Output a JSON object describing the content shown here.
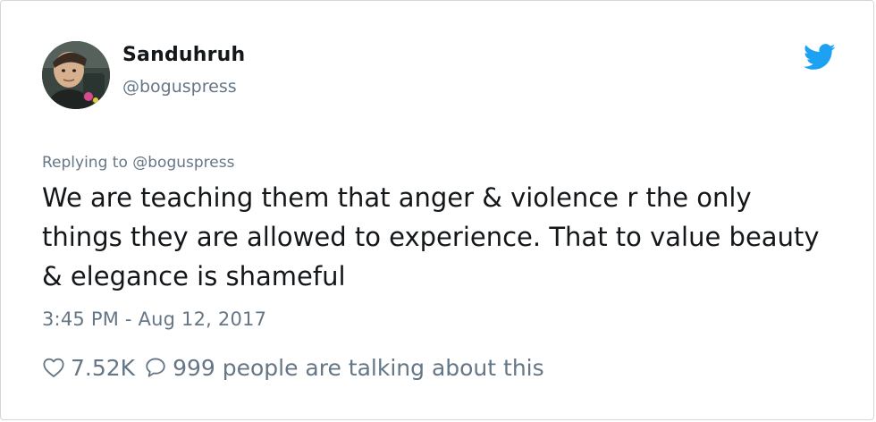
{
  "tweet": {
    "author": {
      "display_name": "Sanduhruh",
      "handle": "@boguspress"
    },
    "replying_to": {
      "prefix": "Replying to",
      "handle": "@boguspress"
    },
    "text": "We are teaching them that anger & violence r the only things they are allowed to experience. That to value beauty & elegance is shameful",
    "timestamp": "3:45 PM - Aug 12, 2017",
    "likes": "7.52K",
    "conversation": "999 people are talking about this"
  },
  "icons": {
    "brand": "twitter-bird-icon",
    "like": "heart-icon",
    "reply": "speech-bubble-icon"
  },
  "colors": {
    "twitter_blue": "#1da1f2",
    "text_primary": "#14171a",
    "text_secondary": "#657786"
  }
}
